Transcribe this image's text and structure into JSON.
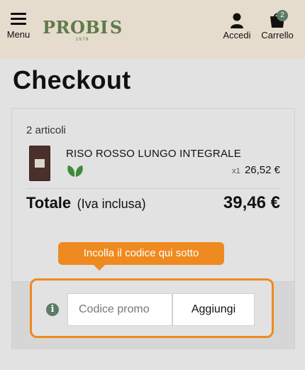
{
  "header": {
    "menu_label": "Menu",
    "logo_text": "PROBIOS",
    "logo_year": "1978",
    "login_label": "Accedi",
    "cart_label": "Carrello",
    "cart_count": "2"
  },
  "page": {
    "title": "Checkout"
  },
  "summary": {
    "count_text": "2 articoli",
    "items": [
      {
        "name": "RISO ROSSO LUNGO INTEGRALE",
        "qty": "x1",
        "price": "26,52 €",
        "badge_icon": "leaf-icon"
      }
    ],
    "total_label": "Totale",
    "total_note": "(Iva inclusa)",
    "total_value": "39,46 €"
  },
  "promo": {
    "tooltip": "Incolla il codice qui sotto",
    "placeholder": "Codice promo",
    "button_label": "Aggiungi",
    "info_icon": "info-icon"
  },
  "colors": {
    "header_bg": "#e6dccd",
    "brand_green": "#5e7a4a",
    "accent_orange": "#ee8a1f",
    "badge_green": "#5b7a67"
  }
}
